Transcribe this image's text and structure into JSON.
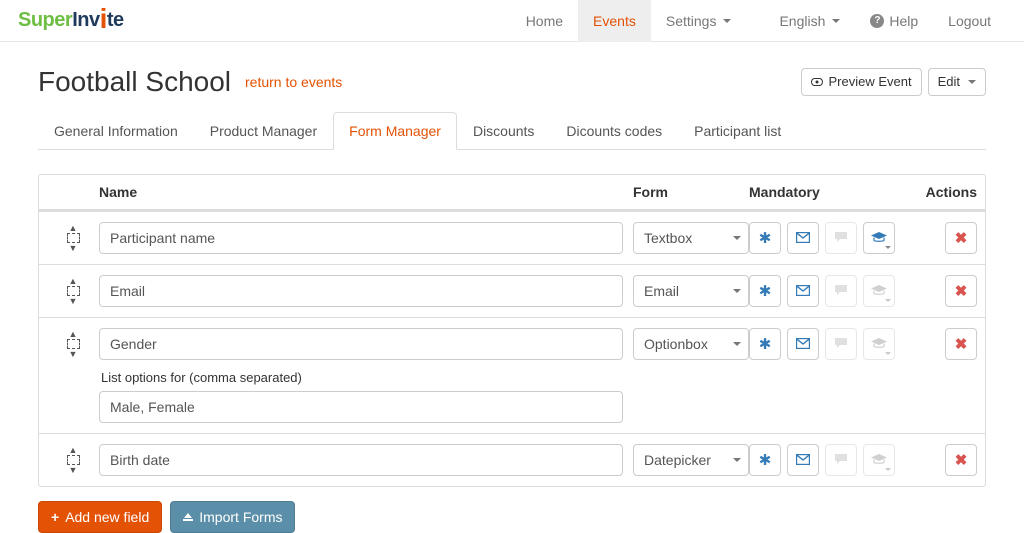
{
  "brand": {
    "part1": "Super",
    "part2": "Inv",
    "part3": "te"
  },
  "nav": {
    "home": "Home",
    "events": "Events",
    "settings": "Settings",
    "language": "English",
    "help": "Help",
    "logout": "Logout"
  },
  "header": {
    "title": "Football School",
    "return": "return to events",
    "preview": "Preview Event",
    "edit": "Edit"
  },
  "tabs": [
    {
      "label": "General Information",
      "active": false
    },
    {
      "label": "Product Manager",
      "active": false
    },
    {
      "label": "Form Manager",
      "active": true
    },
    {
      "label": "Discounts",
      "active": false
    },
    {
      "label": "Dicounts codes",
      "active": false
    },
    {
      "label": "Participant list",
      "active": false
    }
  ],
  "table": {
    "headers": {
      "name": "Name",
      "form": "Form",
      "mandatory": "Mandatory",
      "actions": "Actions"
    },
    "options_label": "List options for (comma separated)",
    "rows": [
      {
        "name": "Participant name",
        "form": "Textbox",
        "options": null,
        "hat_active": true
      },
      {
        "name": "Email",
        "form": "Email",
        "options": null,
        "hat_active": false
      },
      {
        "name": "Gender",
        "form": "Optionbox",
        "options": "Male, Female",
        "hat_active": false
      },
      {
        "name": "Birth date",
        "form": "Datepicker",
        "options": null,
        "hat_active": false
      }
    ]
  },
  "actions": {
    "add": "Add new field",
    "import": "Import Forms"
  }
}
